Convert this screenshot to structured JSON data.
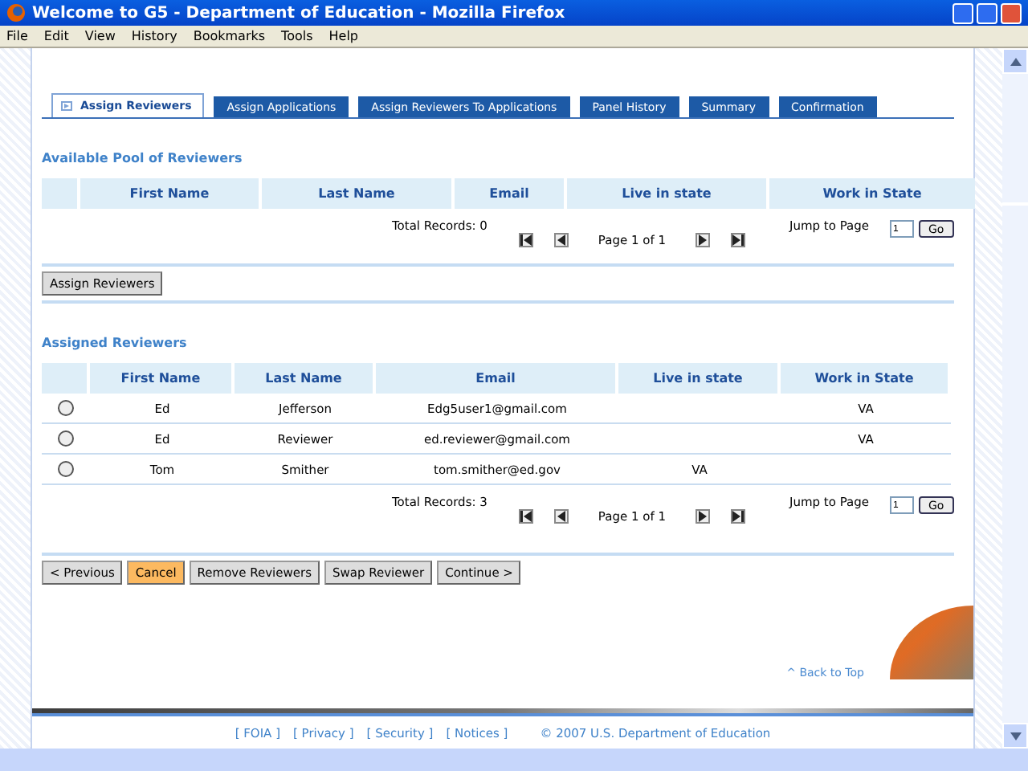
{
  "window": {
    "title": "Welcome to G5 - Department of Education - Mozilla Firefox"
  },
  "menu": [
    "File",
    "Edit",
    "View",
    "History",
    "Bookmarks",
    "Tools",
    "Help"
  ],
  "tabs": [
    {
      "label": "Assign Reviewers",
      "selected": true
    },
    {
      "label": "Assign Applications",
      "selected": false
    },
    {
      "label": "Assign Reviewers To Applications",
      "selected": false
    },
    {
      "label": "Panel History",
      "selected": false
    },
    {
      "label": "Summary",
      "selected": false
    },
    {
      "label": "Confirmation",
      "selected": false
    }
  ],
  "pool": {
    "title": "Available Pool of Reviewers",
    "columns": [
      "First Name",
      "Last Name",
      "Email",
      "Live in state",
      "Work in State"
    ],
    "pager": {
      "total": "Total Records: 0",
      "page": "Page 1 of 1",
      "jump_label": "Jump to Page",
      "jump_value": "1",
      "go": "Go"
    },
    "button": "Assign Reviewers"
  },
  "assigned": {
    "title": "Assigned Reviewers",
    "columns": [
      "First Name",
      "Last Name",
      "Email",
      "Live in state",
      "Work in State"
    ],
    "rows": [
      {
        "selected": false,
        "cells": [
          "Ed",
          "Jefferson",
          "Edg5user1@gmail.com",
          "",
          "VA"
        ]
      },
      {
        "selected": false,
        "cells": [
          "Ed",
          "Reviewer",
          "ed.reviewer@gmail.com",
          "",
          "VA"
        ]
      },
      {
        "selected": false,
        "cells": [
          "Tom",
          "Smither",
          "tom.smither@ed.gov",
          "VA",
          ""
        ]
      }
    ],
    "pager": {
      "total": "Total Records: 3",
      "page": "Page 1 of 1",
      "jump_label": "Jump to Page",
      "jump_value": "1",
      "go": "Go"
    }
  },
  "actions": [
    {
      "label": "< Previous",
      "kind": "normal"
    },
    {
      "label": "Cancel",
      "kind": "highlight"
    },
    {
      "label": "Remove Reviewers",
      "kind": "normal"
    },
    {
      "label": "Swap Reviewer",
      "kind": "normal"
    },
    {
      "label": "Continue >",
      "kind": "normal"
    }
  ],
  "back_to_top": "^ Back to Top",
  "footer": {
    "links": [
      "[ FOIA ]",
      "[ Privacy ]",
      "[ Security ]",
      "[ Notices ]"
    ],
    "copyright": "© 2007 U.S. Department of Education"
  }
}
